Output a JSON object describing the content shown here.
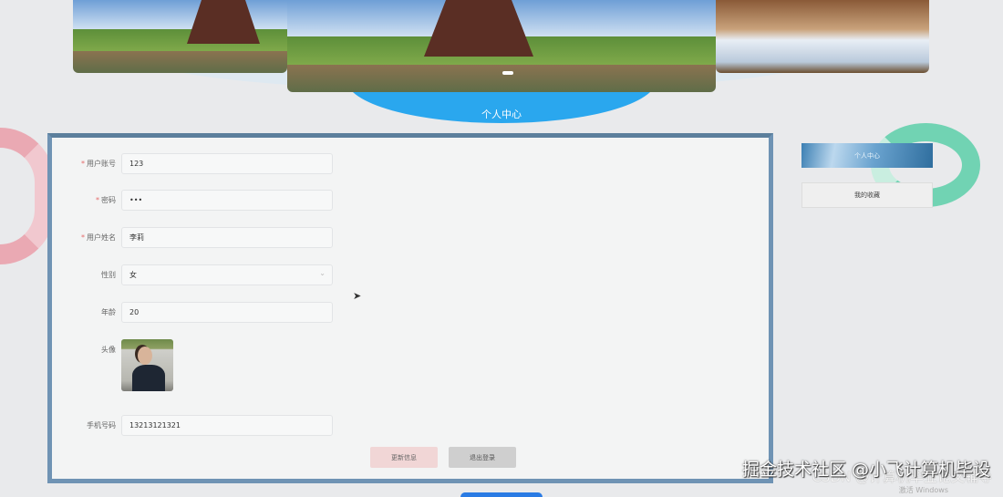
{
  "page_title": "个人中心",
  "form": {
    "fields": [
      {
        "label": "用户账号",
        "required": true,
        "value": "123"
      },
      {
        "label": "密码",
        "required": true,
        "value": "•••"
      },
      {
        "label": "用户姓名",
        "required": true,
        "value": "李莉"
      },
      {
        "label": "性别",
        "required": false,
        "value": "女"
      },
      {
        "label": "年龄",
        "required": false,
        "value": "20"
      }
    ],
    "avatar_label": "头像",
    "phone": {
      "label": "手机号码",
      "value": "13213121321"
    },
    "required_mark": "*",
    "update_button": "更新信息",
    "logout_button": "退出登录"
  },
  "side_menu": [
    {
      "label": "个人中心",
      "active": true
    },
    {
      "label": "我的收藏",
      "active": false
    }
  ],
  "watermarks": {
    "juejin": "掘金技术社区 @小飞计算机毕设",
    "csdn": "CSDN @计算机毕业论文辅导",
    "windows": "激活 Windows"
  },
  "colors": {
    "panel_border": "#6f93b4",
    "accent_blue": "#2aa7ee",
    "update_btn": "#f1d6d6",
    "logout_btn": "#cfcfcf"
  }
}
